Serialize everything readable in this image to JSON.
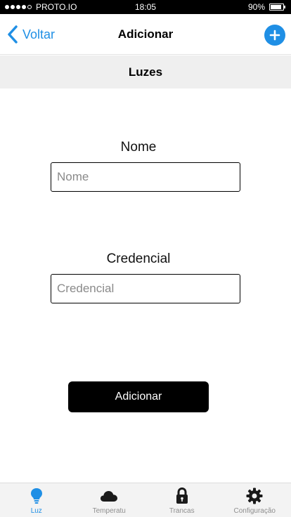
{
  "status_bar": {
    "carrier": "PROTO.IO",
    "time": "18:05",
    "battery_percent": "90%",
    "battery_level": 0.9,
    "signal_filled": 4,
    "signal_total": 5
  },
  "nav": {
    "back_label": "Voltar",
    "title": "Adicionar",
    "back_icon": "chevron-left-icon",
    "action_icon": "plus-icon"
  },
  "section": {
    "title": "Luzes"
  },
  "form": {
    "name_label": "Nome",
    "name_placeholder": "Nome",
    "name_value": "",
    "credential_label": "Credencial",
    "credential_placeholder": "Credencial",
    "credential_value": "",
    "submit_label": "Adicionar"
  },
  "tabs": [
    {
      "label": "Luz",
      "icon": "lightbulb-icon",
      "active": true
    },
    {
      "label": "Temperatu",
      "icon": "cloud-icon",
      "active": false
    },
    {
      "label": "Trancas",
      "icon": "lock-icon",
      "active": false
    },
    {
      "label": "Configuração",
      "icon": "gear-icon",
      "active": false
    }
  ],
  "colors": {
    "accent": "#1f8fe5",
    "tab_inactive": "#8e8e8e",
    "section_bg": "#efefef",
    "button_bg": "#000000"
  }
}
